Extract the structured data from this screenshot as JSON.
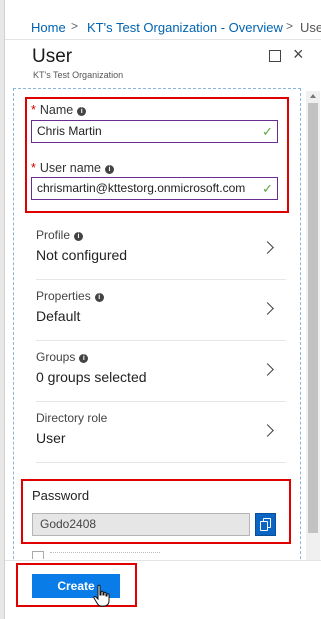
{
  "breadcrumb": {
    "items": [
      "Home",
      "KT's Test Organization - Overview",
      "Use"
    ],
    "separator": ">"
  },
  "blade": {
    "title": "User",
    "subtitle": "KT's Test Organization",
    "maximize_icon": "maximize-icon",
    "close_icon": "close-icon",
    "close_glyph": "×"
  },
  "form": {
    "name": {
      "label": "Name",
      "required": "*",
      "info": "i",
      "value": "Chris Martin",
      "valid_glyph": "✓"
    },
    "username": {
      "label": "User name",
      "required": "*",
      "info": "i",
      "value": "chrismartin@kttestorg.onmicrosoft.com",
      "valid_glyph": "✓"
    },
    "rows": [
      {
        "title": "Profile",
        "info": "i",
        "value": "Not configured"
      },
      {
        "title": "Properties",
        "info": "i",
        "value": "Default"
      },
      {
        "title": "Groups",
        "info": "i",
        "value": "0 groups selected"
      },
      {
        "title": "Directory role",
        "value": "User"
      }
    ],
    "password": {
      "label": "Password",
      "value": "Godo2408"
    }
  },
  "footer": {
    "create_label": "Create"
  },
  "colors": {
    "accent": "#0a7ce8",
    "highlight": "#e00000",
    "valid": "#5aa53b",
    "focus_border": "#6a2c91"
  }
}
